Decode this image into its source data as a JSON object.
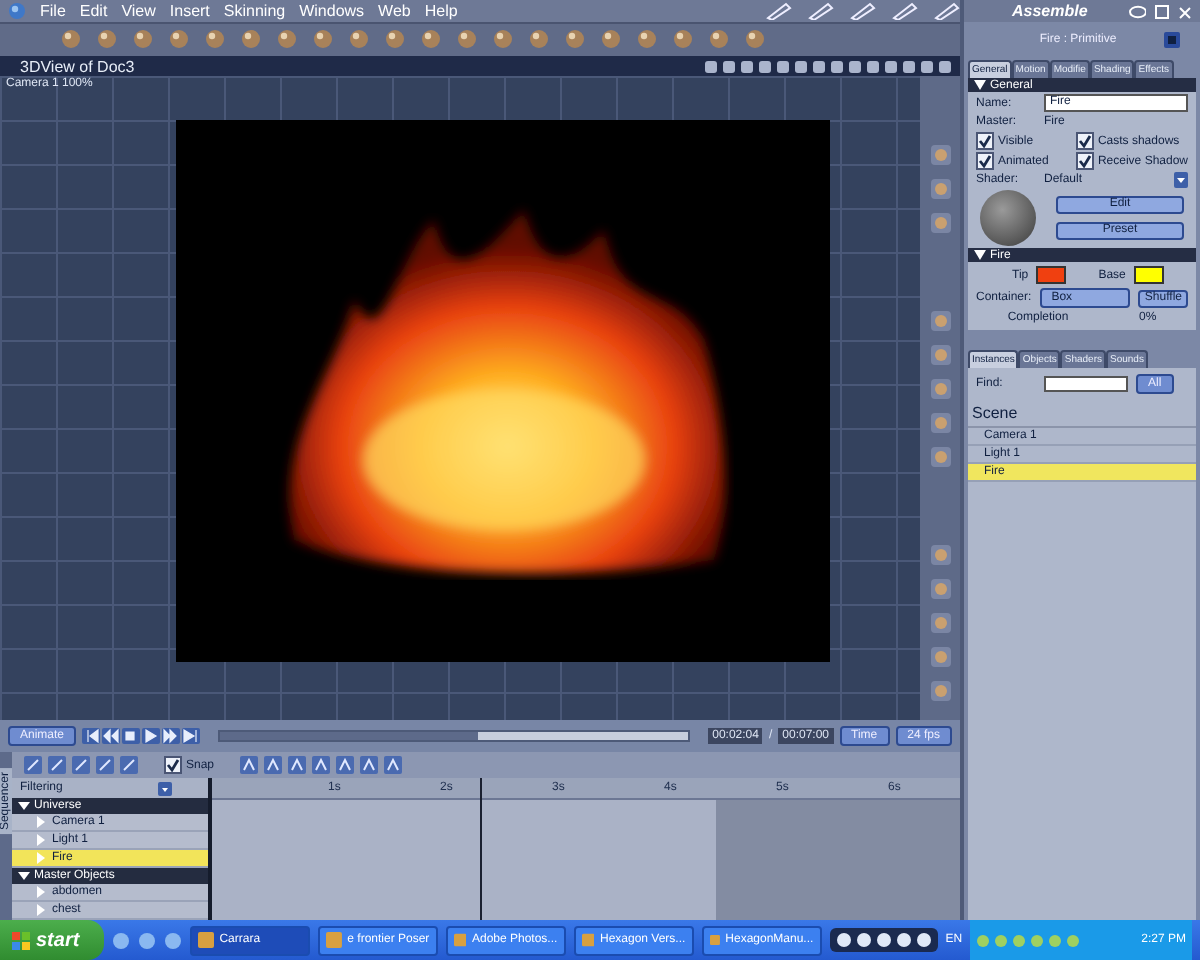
{
  "menu": [
    "File",
    "Edit",
    "View",
    "Insert",
    "Skinning",
    "Windows",
    "Web",
    "Help"
  ],
  "room": "Assemble",
  "view": {
    "title": "3DView of Doc3",
    "camera": "Camera 1 100%"
  },
  "properties": {
    "title": "Fire : Primitive",
    "tabs": [
      {
        "label": "General",
        "selected": true
      },
      {
        "label": "Motion",
        "selected": false
      },
      {
        "label": "Modifie",
        "selected": false
      },
      {
        "label": "Shading",
        "selected": false
      },
      {
        "label": "Effects",
        "selected": false
      }
    ],
    "general_header": "General",
    "fields": [
      {
        "label": "Name:",
        "value": "Fire",
        "kind": "input"
      },
      {
        "label": "Master:",
        "value": "Fire",
        "kind": "text"
      }
    ],
    "checkboxes": [
      {
        "label": "Visible",
        "checked": true
      },
      {
        "label": "Casts shadows",
        "checked": true
      },
      {
        "label": "Animated",
        "checked": true
      },
      {
        "label": "Receive Shadow",
        "checked": true
      }
    ],
    "shader": {
      "label": "Shader:",
      "value": "Default",
      "buttons": [
        "Edit",
        "Preset"
      ]
    },
    "fire_header": "Fire",
    "colors": [
      {
        "label": "Tip",
        "color": "#f04010"
      },
      {
        "label": "Base",
        "color": "#ffff00"
      }
    ],
    "container": {
      "label": "Container:",
      "value": "Box"
    },
    "shuffle": "Shuffle",
    "completion": {
      "label": "Completion",
      "value": "0%"
    }
  },
  "browser": {
    "tabs": [
      {
        "label": "Instances",
        "selected": true
      },
      {
        "label": "Objects",
        "selected": false
      },
      {
        "label": "Shaders",
        "selected": false
      },
      {
        "label": "Sounds",
        "selected": false
      }
    ],
    "find_label": "Find:",
    "filter": "All",
    "items": [
      {
        "label": "Scene",
        "kind": "heading"
      },
      {
        "label": "Camera 1",
        "kind": "item",
        "selected": false
      },
      {
        "label": "Light 1",
        "kind": "item",
        "selected": false
      },
      {
        "label": "Fire",
        "kind": "item",
        "selected": true
      }
    ]
  },
  "transport": {
    "mode": "Animate",
    "level": 0.55,
    "current": "00:02:04",
    "separator": "/",
    "total": "00:07:00",
    "units": "Time",
    "fps": "24 fps"
  },
  "timeline": {
    "side_tab": "Sequencer",
    "snap": {
      "label": "Snap",
      "checked": true
    },
    "filter_label": "Filtering",
    "ruler": [
      "1s",
      "2s",
      "3s",
      "4s",
      "5s",
      "6s"
    ],
    "playhead": {
      "level": 0.34
    },
    "tree": [
      {
        "label": "Universe",
        "expanded": true,
        "children": [
          {
            "label": "Camera 1",
            "expanded": false,
            "selected": false
          },
          {
            "label": "Light 1",
            "expanded": false,
            "selected": false
          },
          {
            "label": "Fire",
            "expanded": false,
            "selected": true
          }
        ]
      },
      {
        "label": "Master Objects",
        "expanded": true,
        "children": [
          {
            "label": "abdomen",
            "expanded": false,
            "selected": false
          },
          {
            "label": "chest",
            "expanded": false,
            "selected": false
          }
        ]
      }
    ]
  },
  "taskbar": {
    "start": "start",
    "tasks": [
      {
        "label": "Carrara",
        "selected": true
      },
      {
        "label": "e frontier Poser",
        "selected": false
      },
      {
        "label": "Adobe Photos...",
        "selected": false
      },
      {
        "label": "Hexagon Vers...",
        "selected": false
      },
      {
        "label": "HexagonManu...",
        "selected": false
      }
    ],
    "lang": "EN",
    "clock": "2:27 PM"
  }
}
